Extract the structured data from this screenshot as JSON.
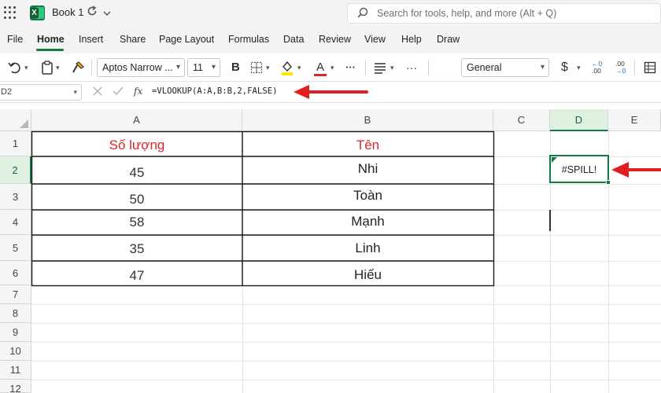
{
  "titlebar": {
    "doc_title": "Book 1",
    "search_placeholder": "Search for tools, help, and more (Alt + Q)",
    "icons": [
      "app-launcher-icon",
      "excel-logo-icon",
      "autosave-sync-icon",
      "chevron-down-icon",
      "search-icon"
    ]
  },
  "menu": {
    "items": [
      "File",
      "Home",
      "Insert",
      "Share",
      "Page Layout",
      "Formulas",
      "Data",
      "Review",
      "View",
      "Help",
      "Draw"
    ],
    "active": "Home"
  },
  "ribbon": {
    "font_name": "Aptos Narrow ...",
    "font_size": "11",
    "bold_label": "B",
    "font_color_label": "A",
    "more_label": "···",
    "number_format": "General",
    "currency_label": "$",
    "decimal_increase_label": ".00",
    "decimal_decrease_label": ".00",
    "icons": [
      "undo-icon",
      "clipboard-paste-icon",
      "format-painter-icon",
      "borders-icon",
      "fill-color-icon",
      "font-color-icon",
      "more-icon",
      "align-icon",
      "currency-icon",
      "increase-decimal-icon",
      "decrease-decimal-icon",
      "table-icon"
    ]
  },
  "formula_bar": {
    "name_box": "D2",
    "fx_label": "fx",
    "formula": "=VLOOKUP(A:A,B:B,2,FALSE)"
  },
  "sheet": {
    "columns": [
      "A",
      "B",
      "C",
      "D",
      "E"
    ],
    "rows": [
      "1",
      "2",
      "3",
      "4",
      "5",
      "6",
      "7",
      "8",
      "9",
      "10",
      "11",
      "12"
    ],
    "selected_column": "D",
    "selected_row": "2",
    "header_a": "Số lượng",
    "header_b": "Tên",
    "data": [
      {
        "qty": "45",
        "name": "Nhi"
      },
      {
        "qty": "50",
        "name": "Toàn"
      },
      {
        "qty": "58",
        "name": "Mạnh"
      },
      {
        "qty": "35",
        "name": "Linh"
      },
      {
        "qty": "47",
        "name": "Hiếu"
      }
    ],
    "active_cell_value": "#SPILL!",
    "header_text_color": "#d9262c",
    "accent_color": "#107c41",
    "annotation_arrow_color": "#e02020"
  }
}
